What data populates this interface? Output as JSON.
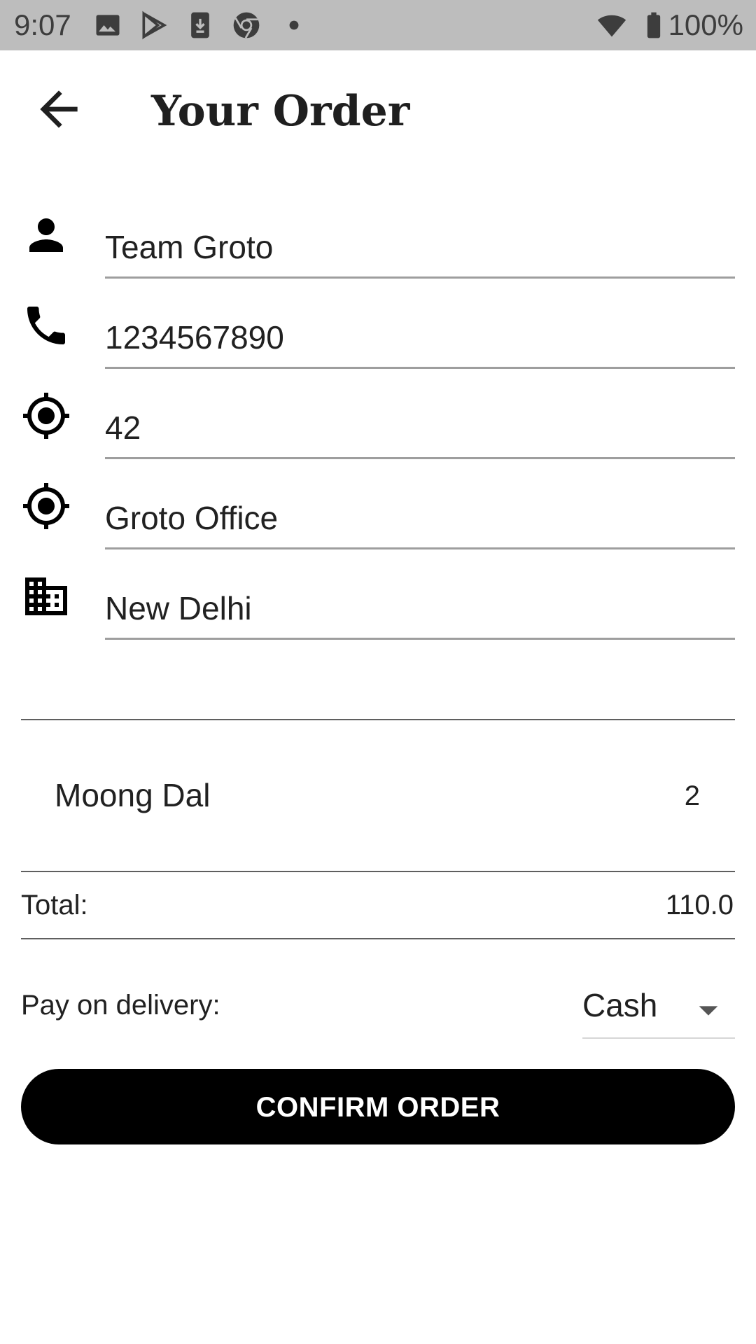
{
  "status_bar": {
    "time": "9:07",
    "battery": "100%",
    "icons": [
      "image-icon",
      "play-store-icon",
      "download-icon",
      "chrome-icon",
      "dot-icon",
      "wifi-icon",
      "battery-icon"
    ]
  },
  "app_bar": {
    "back_icon": "arrow-back-icon",
    "title": "Your Order"
  },
  "form": {
    "name": {
      "icon": "person-icon",
      "value": "Team Groto"
    },
    "phone": {
      "icon": "phone-icon",
      "value": "1234567890"
    },
    "house": {
      "icon": "location-target-icon",
      "value": "42"
    },
    "locality": {
      "icon": "location-target-icon",
      "value": "Groto Office"
    },
    "city": {
      "icon": "city-icon",
      "value": "New Delhi"
    }
  },
  "order": {
    "items": [
      {
        "name": "Moong Dal",
        "qty": "2"
      }
    ],
    "total_label": "Total:",
    "total_value": "110.0"
  },
  "payment": {
    "label": "Pay on delivery:",
    "selected": "Cash",
    "dropdown_icon": "arrow-drop-down-icon"
  },
  "confirm_button": {
    "label": "CONFIRM ORDER"
  },
  "colors": {
    "status_bar_bg": "#bdbdbd",
    "accent": "#000000",
    "underline": "#9e9e9e"
  }
}
